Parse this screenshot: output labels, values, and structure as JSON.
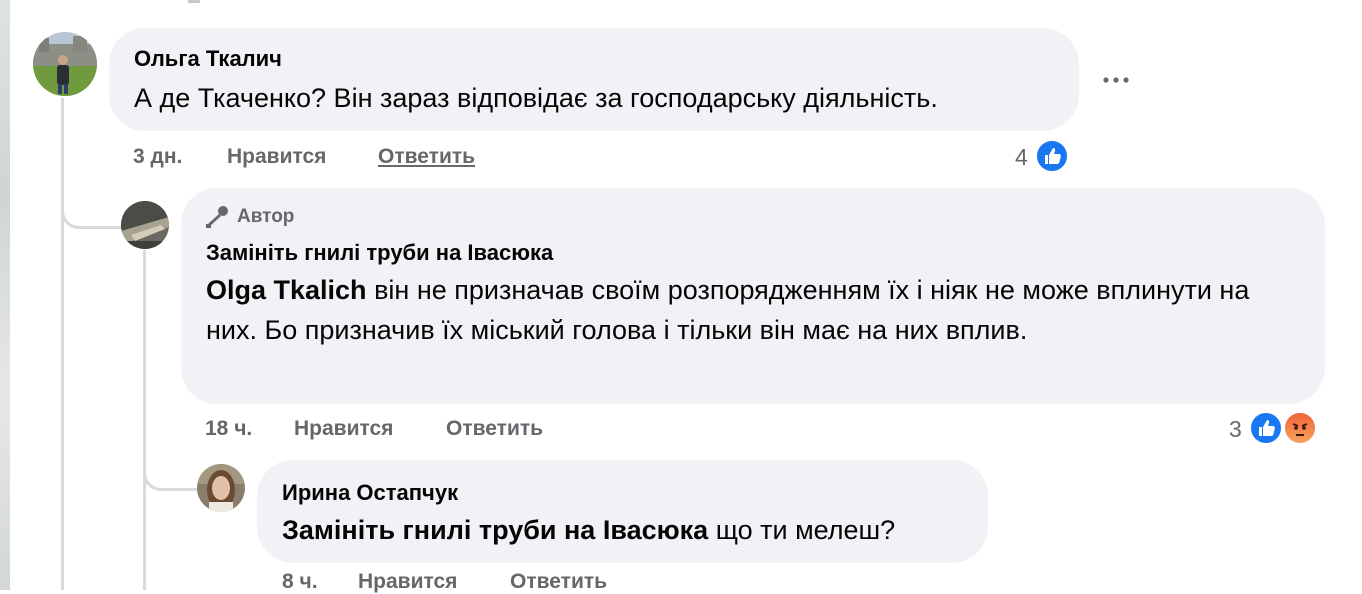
{
  "comments": [
    {
      "author": "Ольга Ткалич",
      "text": "А де Ткаченко? Він зараз відповідає за господарську діяльність.",
      "time": "3 дн.",
      "like_label": "Нравится",
      "reply_label": "Ответить",
      "reaction_count": "4",
      "reactions": [
        "like-icon"
      ],
      "more_icon": "more-horizontal-icon"
    },
    {
      "badge": "Автор",
      "badge_icon": "microphone-icon",
      "author": "Замініть гнилі труби на Івасюка",
      "mention": "Olga Tkalich",
      "text": " він не призначав своїм розпорядженням їх і ніяк не може вплинути на них. Бо призначив їх міський голова і тільки він має на них вплив.",
      "time": "18 ч.",
      "like_label": "Нравится",
      "reply_label": "Ответить",
      "reaction_count": "3",
      "reactions": [
        "like-icon",
        "angry-icon"
      ]
    },
    {
      "author": "Ирина Остапчук",
      "mention": "Замініть гнилі труби на Івасюка",
      "text": " що ти мелеш?",
      "time": "8 ч.",
      "like_label": "Нравится",
      "reply_label": "Ответить"
    }
  ],
  "colors": {
    "bubble": "#f0f2f5",
    "meta_text": "#65676b",
    "like_blue": "#1877f2",
    "thread_line": "#d6d9dd"
  }
}
